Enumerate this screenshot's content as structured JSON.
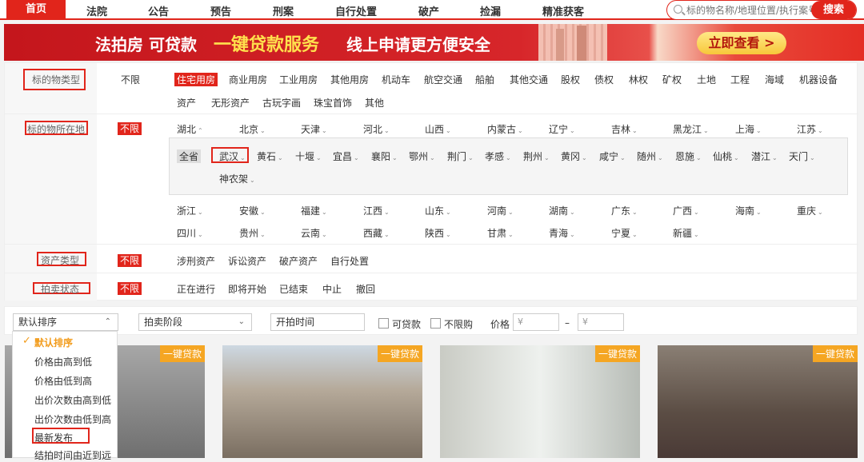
{
  "nav": {
    "items": [
      "首页",
      "法院",
      "公告",
      "预告",
      "刑案",
      "自行处置",
      "破产",
      "捡漏",
      "精准获客"
    ],
    "search_placeholder": "标的物名称/地理位置/执行案号",
    "search_button": "搜索"
  },
  "banner": {
    "text1": "法拍房 可贷款",
    "text2": "一键贷款服务",
    "text3": "线上申请更方便安全",
    "cta": "立即查看 >"
  },
  "filters": {
    "type_label": "标的物类型",
    "type_unlimited": "不限",
    "type_options_row1": [
      "住宅用房",
      "商业用房",
      "工业用房",
      "其他用房",
      "机动车",
      "航空交通",
      "船舶",
      "其他交通",
      "股权",
      "债权",
      "林权",
      "矿权",
      "土地",
      "工程",
      "海域",
      "机器设备"
    ],
    "type_options_row2": [
      "资产",
      "无形资产",
      "古玩字画",
      "珠宝首饰",
      "其他"
    ],
    "location_label": "标的物所在地",
    "location_unlimited": "不限",
    "provinces_row1": [
      "湖北",
      "北京",
      "天津",
      "河北",
      "山西",
      "内蒙古",
      "辽宁",
      "吉林",
      "黑龙江",
      "上海",
      "江苏"
    ],
    "all_province": "全省",
    "cities_row1": [
      "武汉",
      "黄石",
      "十堰",
      "宜昌",
      "襄阳",
      "鄂州",
      "荆门",
      "孝感",
      "荆州",
      "黄冈",
      "咸宁",
      "随州",
      "恩施",
      "仙桃",
      "潜江",
      "天门"
    ],
    "cities_row2": [
      "神农架"
    ],
    "provinces_row2": [
      "浙江",
      "安徽",
      "福建",
      "江西",
      "山东",
      "河南",
      "湖南",
      "广东",
      "广西",
      "海南",
      "重庆"
    ],
    "provinces_row3": [
      "四川",
      "贵州",
      "云南",
      "西藏",
      "陕西",
      "甘肃",
      "青海",
      "宁夏",
      "新疆"
    ],
    "asset_label": "资产类型",
    "asset_unlimited": "不限",
    "asset_options": [
      "涉刑资产",
      "诉讼资产",
      "破产资产",
      "自行处置"
    ],
    "status_label": "拍卖状态",
    "status_unlimited": "不限",
    "status_options": [
      "正在进行",
      "即将开始",
      "已结束",
      "中止",
      "撤回"
    ]
  },
  "sortbar": {
    "sort_select": "默认排序",
    "stage_select": "拍卖阶段",
    "time_input": "开拍时间",
    "loanable": "可贷款",
    "no_limit_buy": "不限购",
    "price_label": "价格",
    "price_min_placeholder": "¥",
    "price_sep": "–",
    "price_max_placeholder": "¥"
  },
  "sort_options": [
    "默认排序",
    "价格由高到低",
    "价格由低到高",
    "出价次数由高到低",
    "出价次数由低到高",
    "最新发布",
    "结拍时间由近到远"
  ],
  "cards": [
    {
      "tag": "一键贷款"
    },
    {
      "tag": "一键贷款"
    },
    {
      "tag": "一键贷款"
    },
    {
      "tag": "一键贷款"
    }
  ],
  "colors": {
    "accent": "#e1251b",
    "tag": "#f5a623",
    "check": "#f29b1a"
  }
}
